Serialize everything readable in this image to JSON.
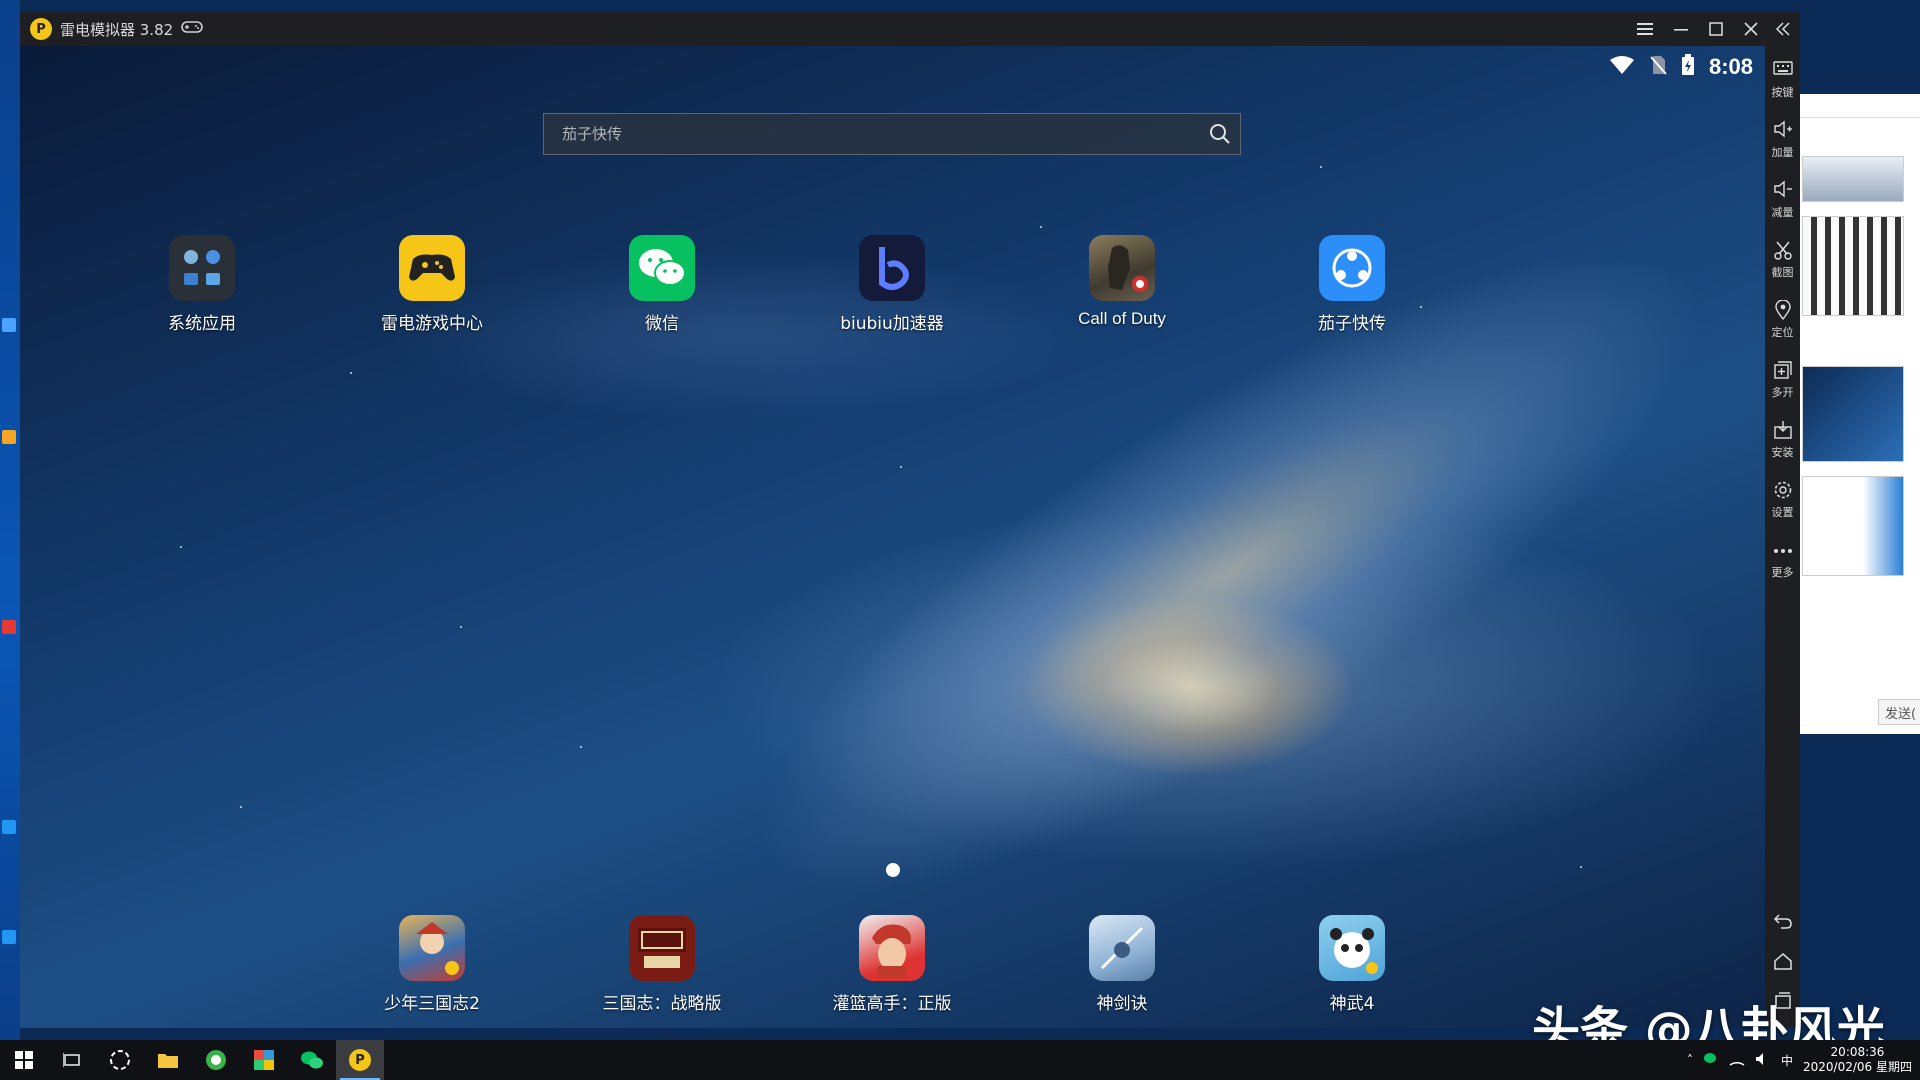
{
  "window": {
    "title": "雷电模拟器 3.82",
    "controls": [
      "menu-icon",
      "minimize-icon",
      "maximize-icon",
      "close-icon",
      "collapse-icon"
    ]
  },
  "status_bar": {
    "time": "8:08"
  },
  "search": {
    "placeholder": "茄子快传"
  },
  "apps_top": [
    {
      "label": "系统应用",
      "icon": "system-apps-folder-icon"
    },
    {
      "label": "雷电游戏中心",
      "icon": "gamepad-icon"
    },
    {
      "label": "微信",
      "icon": "wechat-icon"
    },
    {
      "label": "biubiu加速器",
      "icon": "biubiu-icon"
    },
    {
      "label": "Call of Duty",
      "icon": "call-of-duty-icon"
    },
    {
      "label": "茄子快传",
      "icon": "shareit-icon"
    }
  ],
  "apps_dock": [
    {
      "label": "少年三国志2",
      "icon": "game-shaonian-icon"
    },
    {
      "label": "三国志：战略版",
      "icon": "game-sanguozhi-icon"
    },
    {
      "label": "灌篮高手：正版",
      "icon": "game-slamdunk-icon"
    },
    {
      "label": "神剑诀",
      "icon": "game-shenjianjue-icon"
    },
    {
      "label": "神武4",
      "icon": "game-shenwu-icon"
    }
  ],
  "sidebar": {
    "items": [
      {
        "label": "按键",
        "icon": "keyboard-icon"
      },
      {
        "label": "加量",
        "icon": "volume-up-icon"
      },
      {
        "label": "减量",
        "icon": "volume-down-icon"
      },
      {
        "label": "截图",
        "icon": "scissors-icon"
      },
      {
        "label": "定位",
        "icon": "location-icon"
      },
      {
        "label": "多开",
        "icon": "multi-instance-icon"
      },
      {
        "label": "安装",
        "icon": "apk-install-icon"
      },
      {
        "label": "设置",
        "icon": "gear-icon"
      },
      {
        "label": "更多",
        "icon": "more-icon"
      }
    ],
    "nav": [
      "back-icon",
      "home-icon",
      "recents-icon"
    ]
  },
  "chat_window": {
    "send_label": "发送("
  },
  "taskbar": {
    "clock_time": "20:08:36",
    "clock_date": "2020/02/06 星期四",
    "ime": "中"
  },
  "watermark": "头条 @八卦风光",
  "colors": {
    "titlebar": "#1e1f23",
    "accent_yellow": "#f5c518",
    "wechat_green": "#07c160",
    "shareit_blue": "#2c8ef8"
  }
}
